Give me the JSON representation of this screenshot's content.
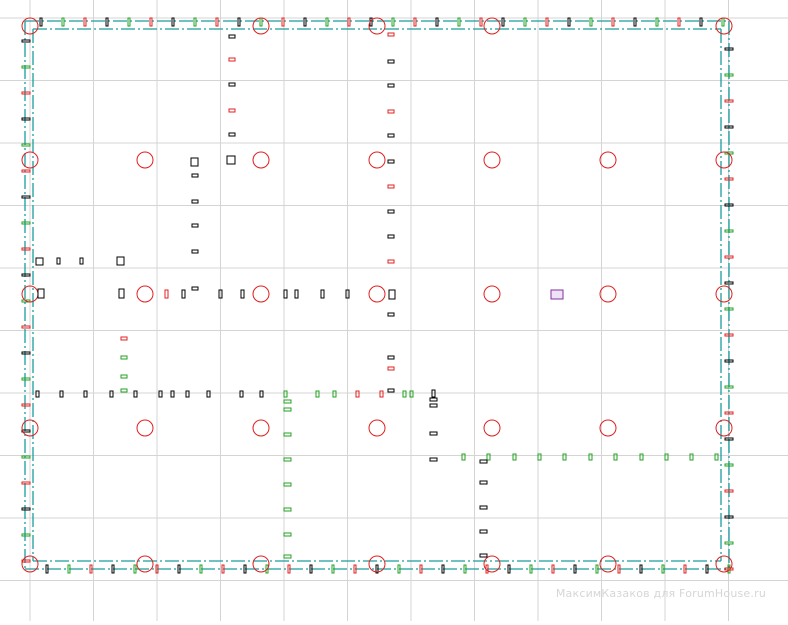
{
  "drawing": {
    "watermark": "МаксимКазаков для ForumHouse.ru",
    "colors": {
      "background": "#ffffff",
      "grid": "#d4d4d4",
      "wall_axis": "#1a9e9e",
      "column_marker": "#e02020",
      "opening_black": "#000000",
      "opening_red": "#e02020",
      "opening_green": "#20a020",
      "highlight_purple": "#8030a0"
    },
    "icons": [
      "column-marker-icon",
      "opening-icon",
      "purple-highlight-icon"
    ]
  }
}
